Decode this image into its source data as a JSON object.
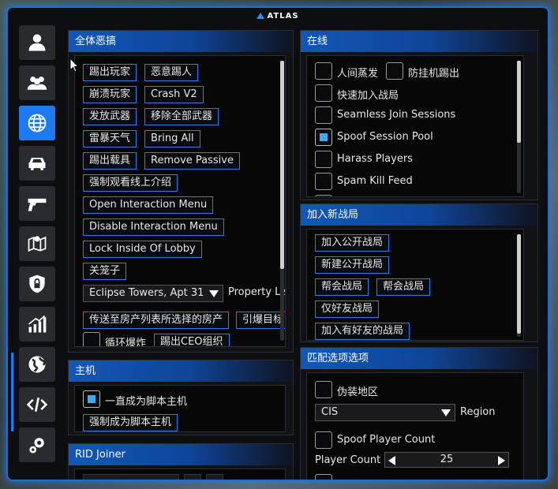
{
  "app": {
    "title": "ATLAS"
  },
  "sidebar": {
    "items": [
      {
        "icon": "person-icon",
        "active": false
      },
      {
        "icon": "group-icon",
        "active": false
      },
      {
        "icon": "globe-network-icon",
        "active": true
      },
      {
        "icon": "car-icon",
        "active": false
      },
      {
        "icon": "pistol-icon",
        "active": false
      },
      {
        "icon": "map-pin-icon",
        "active": false
      },
      {
        "icon": "shield-lock-icon",
        "active": false
      },
      {
        "icon": "chart-icon",
        "active": false
      },
      {
        "icon": "earth-icon",
        "active": false
      },
      {
        "icon": "code-icon",
        "active": false
      },
      {
        "icon": "gears-icon",
        "active": false
      }
    ]
  },
  "troll_all": {
    "title": "全体恶搞",
    "buttons": {
      "kick_players": "踢出玩家",
      "malicious_kick": "恶意踢人",
      "crash_players": "崩溃玩家",
      "crash_v2": "Crash V2",
      "give_weapons": "发放武器",
      "remove_all_weapons": "移除全部武器",
      "thunder_weather": "雷暴天气",
      "bring_all": "Bring All",
      "kick_vehicle": "踢出载具",
      "remove_passive": "Remove Passive",
      "force_watch_intro": "强制观看线上介绍",
      "open_interaction_menu": "Open Interaction Menu",
      "disable_interaction_menu": "Disable Interaction Menu",
      "lock_inside_lobby": "Lock Inside Of Lobby",
      "close_cage": "关笼子",
      "teleport_property": "传送至房产列表所选择的房产",
      "explode_target": "引爆目标",
      "kick_ceo": "踢出CEO组织"
    },
    "property_select": {
      "value": "Eclipse Towers, Apt 31",
      "label": "Property List"
    },
    "loop_explode": {
      "label": "循环爆炸",
      "checked": false
    }
  },
  "host": {
    "title": "主机",
    "always_script_host": {
      "label": "一直成为脚本主机",
      "checked": true
    },
    "force_script_host": "强制成为脚本主机"
  },
  "rid_joiner": {
    "title": "RID Joiner"
  },
  "online": {
    "title": "在线",
    "options": {
      "human_evaporation": {
        "label": "人间蒸发",
        "checked": false
      },
      "anti_afk_kick": {
        "label": "防挂机踢出",
        "checked": false
      },
      "quick_join": {
        "label": "快速加入战局",
        "checked": false
      },
      "seamless_join": {
        "label": "Seamless Join Sessions",
        "checked": false
      },
      "spoof_session_pool": {
        "label": "Spoof Session Pool",
        "checked": true
      },
      "harass_players": {
        "label": "Harass Players",
        "checked": false
      },
      "spam_kill_feed": {
        "label": "Spam Kill Feed",
        "checked": false
      }
    }
  },
  "join_session": {
    "title": "加入新战局",
    "buttons": {
      "join_public": "加入公开战局",
      "new_public": "新建公开战局",
      "crew_session_1": "帮会战局",
      "crew_session_2": "帮会战局",
      "friends_only": "仅好友战局",
      "join_with_friends": "加入有好友的战局"
    }
  },
  "matchmaking": {
    "title": "匹配选项选项",
    "spoof_region": {
      "label": "伪装地区",
      "checked": false
    },
    "region_select": {
      "value": "CIS",
      "label": "Region"
    },
    "spoof_player_count": {
      "label": "Spoof Player Count",
      "checked": false
    },
    "player_count": {
      "label": "Player Count",
      "value": "25"
    }
  }
}
